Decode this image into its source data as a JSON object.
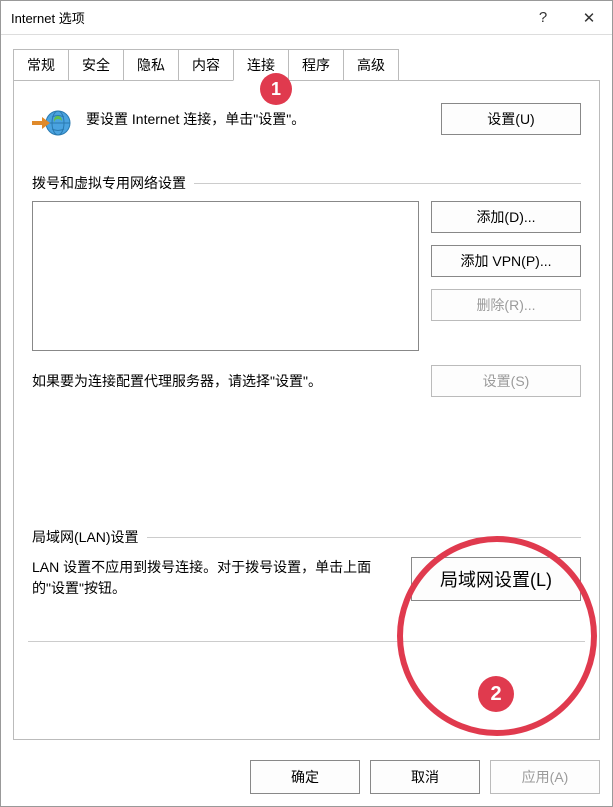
{
  "window": {
    "title": "Internet 选项",
    "help": "?",
    "close": "✕"
  },
  "tabs": [
    "常规",
    "安全",
    "隐私",
    "内容",
    "连接",
    "程序",
    "高级"
  ],
  "activeTab": 4,
  "intro": {
    "text": "要设置 Internet 连接，单击\"设置\"。",
    "setup_btn": "设置(U)"
  },
  "dialup": {
    "label": "拨号和虚拟专用网络设置",
    "add_btn": "添加(D)...",
    "add_vpn_btn": "添加 VPN(P)...",
    "remove_btn": "删除(R)...",
    "proxy_text": "如果要为连接配置代理服务器，请选择\"设置\"。",
    "settings_btn": "设置(S)"
  },
  "lan": {
    "label": "局域网(LAN)设置",
    "text": "LAN 设置不应用到拨号连接。对于拨号设置，单击上面的\"设置\"按钮。",
    "btn": "局域网设置(L)"
  },
  "footer": {
    "ok": "确定",
    "cancel": "取消",
    "apply": "应用(A)"
  },
  "annotations": {
    "badge1": "1",
    "badge2": "2"
  }
}
